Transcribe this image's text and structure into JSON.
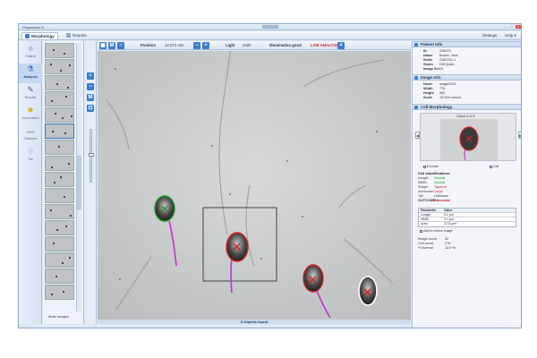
{
  "window": {
    "title": "Physiomics X"
  },
  "menubar": {
    "tabs": [
      {
        "label": "Morphology",
        "active": true
      },
      {
        "label": "Reports",
        "active": false
      }
    ],
    "settings_label": "Settings",
    "help_label": "Help"
  },
  "nav": {
    "items": [
      {
        "label": "Patient",
        "icon": "patient-icon",
        "active": false
      },
      {
        "label": "Analysis",
        "icon": "analysis-icon",
        "active": true
      },
      {
        "label": "Results",
        "icon": "results-icon",
        "active": false
      },
      {
        "label": "Summation",
        "icon": "summation-icon",
        "active": false
      },
      {
        "label": "Calibrate",
        "icon": "calibrate-icon",
        "active": false
      },
      {
        "label": "Tile",
        "icon": "tile-icon",
        "active": false
      }
    ]
  },
  "thumbs": {
    "footer_label": "Most Images"
  },
  "toolbar": {
    "position_label": "Position",
    "position_value": "14.072 mm",
    "light_label": "Light",
    "light_value": "2480",
    "illumination_label": "Illumination good",
    "live_label": "LIVE ANALYSIS"
  },
  "status": {
    "message": "5 Objects found"
  },
  "patient_info": {
    "title": "Patient Info",
    "fields": [
      {
        "key": "ID",
        "value": "228074"
      },
      {
        "key": "Name",
        "value": "Brown, Jack"
      },
      {
        "key": "Smile",
        "value": "2285741-1"
      },
      {
        "key": "Strain",
        "value": "Diff Quick"
      },
      {
        "key": "Image Set",
        "value": "10"
      }
    ]
  },
  "image_info": {
    "title": "Image Info",
    "fields": [
      {
        "key": "Name",
        "value": "image0001"
      },
      {
        "key": "Width",
        "value": "776"
      },
      {
        "key": "Height",
        "value": "582"
      },
      {
        "key": "Scale",
        "value": "13.000 um/um"
      }
    ]
  },
  "cell_morphology": {
    "title": "Cell Morphology",
    "preview_title": "Object 3 of 5",
    "include_label": "Exclude",
    "cell_label": "Cell",
    "classification_title": "Cell classifications:",
    "classifications": [
      {
        "key": "Length",
        "value": "Normal",
        "color": "#1a9a1a"
      },
      {
        "key": "Width",
        "value": "Normal",
        "color": "#1a9a1a"
      },
      {
        "key": "Shape",
        "value": "Tapered",
        "color": "#d62020"
      },
      {
        "key": "Acrosome",
        "value": "Large",
        "color": "#d62020"
      },
      {
        "key": "Tail",
        "value": "Unknown",
        "color": "#333333"
      },
      {
        "key": "OUTCOME:",
        "value": "Abnormal",
        "color": "#d62020"
      }
    ],
    "measurements": {
      "header": [
        "Parameter",
        "Value"
      ],
      "rows": [
        [
          "Length",
          "5.2 µm"
        ],
        [
          "Width",
          "3.1 µm"
        ],
        [
          "Area",
          "12.5 µm²"
        ]
      ]
    },
    "add_note_label": "Add to review image",
    "stats": [
      {
        "key": "Image count",
        "value": "22"
      },
      {
        "key": "Cell count",
        "value": "276"
      },
      {
        "key": "% Normal",
        "value": "13.0 %"
      }
    ]
  },
  "colors": {
    "accent": "#3b7ed0",
    "normal": "#1a9a1a",
    "abnormal": "#d62020",
    "tail": "#c040d0"
  }
}
